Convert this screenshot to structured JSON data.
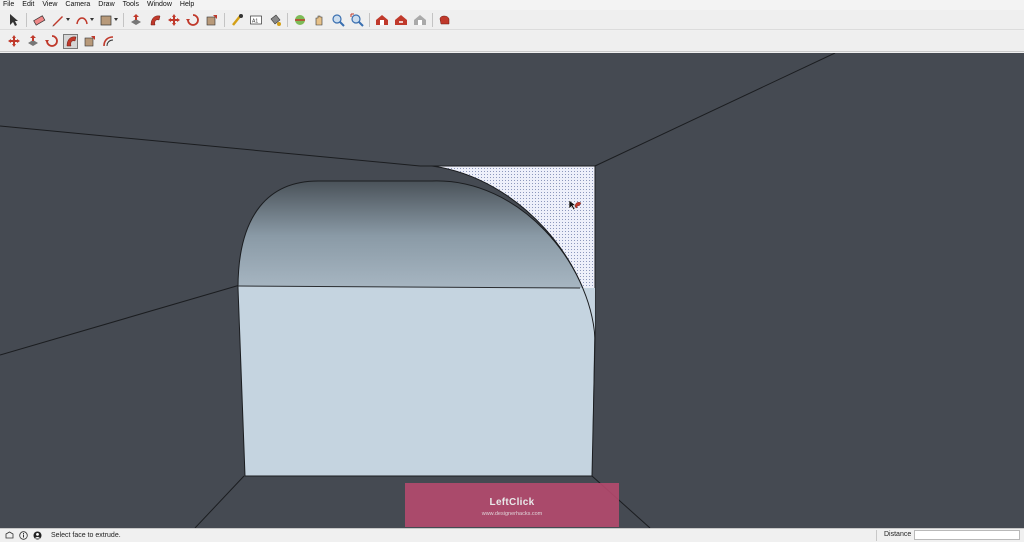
{
  "menu": [
    "File",
    "Edit",
    "View",
    "Camera",
    "Draw",
    "Tools",
    "Window",
    "Help"
  ],
  "toolbar1": [
    {
      "icon": "select-arrow-icon"
    },
    {
      "sep": true
    },
    {
      "icon": "eraser-icon"
    },
    {
      "icon": "pencil-line-icon",
      "dropdown": true
    },
    {
      "icon": "arc-icon",
      "dropdown": true
    },
    {
      "icon": "rectangle-shape-icon",
      "dropdown": true
    },
    {
      "sep": true
    },
    {
      "icon": "push-pull-icon"
    },
    {
      "icon": "follow-me-icon"
    },
    {
      "icon": "move-icon"
    },
    {
      "icon": "rotate-icon"
    },
    {
      "icon": "scale-icon"
    },
    {
      "sep": true
    },
    {
      "icon": "tape-measure-icon"
    },
    {
      "icon": "text-icon"
    },
    {
      "icon": "paint-bucket-icon"
    },
    {
      "sep": true
    },
    {
      "icon": "orbit-icon"
    },
    {
      "icon": "pan-icon"
    },
    {
      "icon": "zoom-icon"
    },
    {
      "icon": "zoom-extents-icon"
    },
    {
      "sep": true
    },
    {
      "icon": "warehouse-icon"
    },
    {
      "icon": "share-model-icon"
    },
    {
      "icon": "components-icon"
    },
    {
      "sep": true
    },
    {
      "icon": "extension-warehouse-icon"
    }
  ],
  "toolbar2": [
    {
      "icon": "move-icon"
    },
    {
      "icon": "push-pull-icon"
    },
    {
      "icon": "rotate-icon"
    },
    {
      "icon": "follow-me-icon",
      "active": true
    },
    {
      "icon": "scale-icon"
    },
    {
      "icon": "offset-icon"
    }
  ],
  "status": {
    "text": "Select face to extrude.",
    "measure_label": "Distance",
    "measure_value": ""
  },
  "watermark": {
    "title": "LeftClick",
    "subtitle": "www.designerhacks.com"
  },
  "colors": {
    "viewport_bg": "#454a52",
    "face_light": "#c5d4e0",
    "selected_face": "#eef0fa",
    "watermark": "#b94a6f"
  }
}
